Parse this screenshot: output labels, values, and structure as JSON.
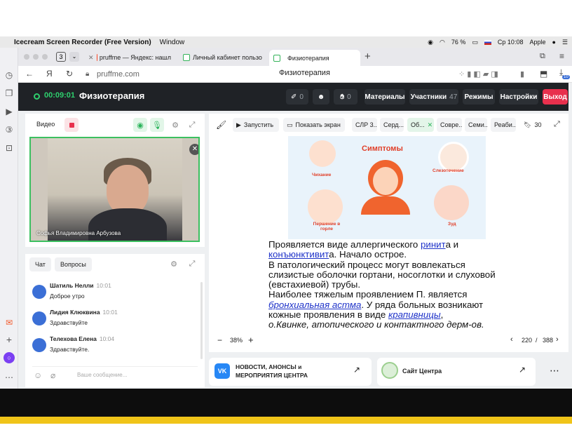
{
  "menubar": {
    "app_name": "Icecream Screen Recorder (Free Version)",
    "menu_window": "Window",
    "battery": "76 %",
    "datetime": "Ср 10:08",
    "user": "Apple"
  },
  "browser": {
    "tab_count": "3",
    "tabs": [
      {
        "label": "pruffme — Яндекс: нашл"
      },
      {
        "label": "Личный кабинет пользо"
      },
      {
        "label": "Физиотерапия"
      }
    ],
    "new_tab": "+",
    "url": "pruffme.com",
    "page_title": "Физиотерапия",
    "download_badge": "10"
  },
  "app_header": {
    "timer": "00:09:01",
    "title": "Физиотерапия",
    "pins_count": "0",
    "hands_count": "0",
    "materials_label": "Материалы",
    "participants_label": "Участники",
    "participants_count": "47",
    "modes_label": "Режимы",
    "settings_label": "Настройки",
    "exit_label": "Выход"
  },
  "video_panel": {
    "label": "Видео",
    "participant_name": "Софья Владимировна Арбузова"
  },
  "chat": {
    "tabs": [
      "Чат",
      "Вопросы"
    ],
    "messages": [
      {
        "name": "Шатиль Нелли",
        "time": "10:01",
        "text": "Доброе утро"
      },
      {
        "name": "Лидия Клюквина",
        "time": "10:01",
        "text": "Здравствуйте"
      },
      {
        "name": "Телехова Елена",
        "time": "10:04",
        "text": "Здравствуйте."
      }
    ],
    "input_placeholder": "Ваше сообщение..."
  },
  "presentation": {
    "start_label": "Запустить",
    "share_screen_label": "Показать экран",
    "doc_tabs": [
      "СЛР 3...",
      "Серд...",
      "Об...",
      "Совре...",
      "Семи...",
      "Реаби..."
    ],
    "bookmarks_count": "30",
    "zoom": "38%",
    "page_current": "220",
    "page_sep": "/",
    "page_total": "388",
    "slide": {
      "image_title": "Симптомы",
      "labels": [
        "Чихание",
        "Слезотечение",
        "Першение в горле",
        "Зуд"
      ],
      "line1_a": "Проявляется виде аллергического ",
      "line1_link": "ринит",
      "line1_b": "а и ",
      "line2_link": "конъюнктивит",
      "line2_b": "а. Начало острое.",
      "line3": "В патологический процесс могут вовлекаться слизистые оболочки гортани, носоглотки и слуховой (евстахиевой) трубы.",
      "line4": "Наиболее тяжелым проявлением П. является ",
      "line4_link": "бронхиальная астма",
      "line4_b": ". У ряда больных возникают кожные проявления в виде ",
      "line4_link2": "крапивницы",
      "line4_c": ",",
      "line5_it": "о.Квинке",
      "line5_b": ", атопического и контактного дерм-ов."
    }
  },
  "cards": [
    {
      "title": "НОВОСТИ, АНОНСЫ и МЕРОПРИЯТИЯ ЦЕНТРА"
    },
    {
      "title": "Сайт Центра"
    }
  ],
  "colors": {
    "accent_green": "#2ed06e",
    "exit_red": "#e8304d",
    "link_blue": "#1f33c9",
    "header_dark": "#1f2226"
  }
}
